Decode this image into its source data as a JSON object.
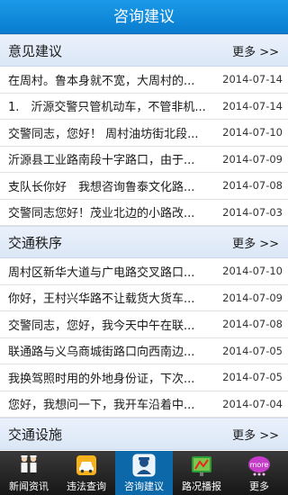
{
  "header": {
    "title": "咨询建议"
  },
  "sections": [
    {
      "title": "意见建议",
      "more": "更多 >>",
      "items": [
        {
          "title": "在周村。鲁本身就不宽，大周村的...",
          "date": "2014-07-14"
        },
        {
          "title": "1.　沂源交警只管机动车，不管非机...",
          "date": "2014-07-14"
        },
        {
          "title": "交警同志，您好！ 周村油坊街北段...",
          "date": "2014-07-10"
        },
        {
          "title": "沂源县工业路南段十字路口，由于...",
          "date": "2014-07-09"
        },
        {
          "title": "支队长你好　我想咨询鲁泰文化路...",
          "date": "2014-07-08"
        },
        {
          "title": "交警同志您好！茂业北边的小路改...",
          "date": "2014-07-03"
        }
      ]
    },
    {
      "title": "交通秩序",
      "more": "更多 >>",
      "items": [
        {
          "title": "周村区新华大道与广电路交叉路口...",
          "date": "2014-07-10"
        },
        {
          "title": "你好，王村兴华路不让载货大货车...",
          "date": "2014-07-09"
        },
        {
          "title": "交警同志，您好，我今天中午在联...",
          "date": "2014-07-08"
        },
        {
          "title": "联通路与义乌商城街路口向西南边...",
          "date": "2014-07-05"
        },
        {
          "title": "我换驾照时用的外地身份证，下次...",
          "date": "2014-07-05"
        },
        {
          "title": "您好，我想问一下，我开车沿着中...",
          "date": "2014-07-04"
        }
      ]
    },
    {
      "title": "交通设施",
      "more": "更多 >>",
      "items": []
    }
  ],
  "tabs": [
    {
      "label": "新闻资讯",
      "icon": "police-officers-icon",
      "active": false
    },
    {
      "label": "违法查询",
      "icon": "car-icon",
      "active": false
    },
    {
      "label": "咨询建议",
      "icon": "officer-badge-icon",
      "active": true
    },
    {
      "label": "路况播报",
      "icon": "road-sign-icon",
      "active": false
    },
    {
      "label": "更多",
      "icon": "more-icon",
      "active": false
    }
  ]
}
